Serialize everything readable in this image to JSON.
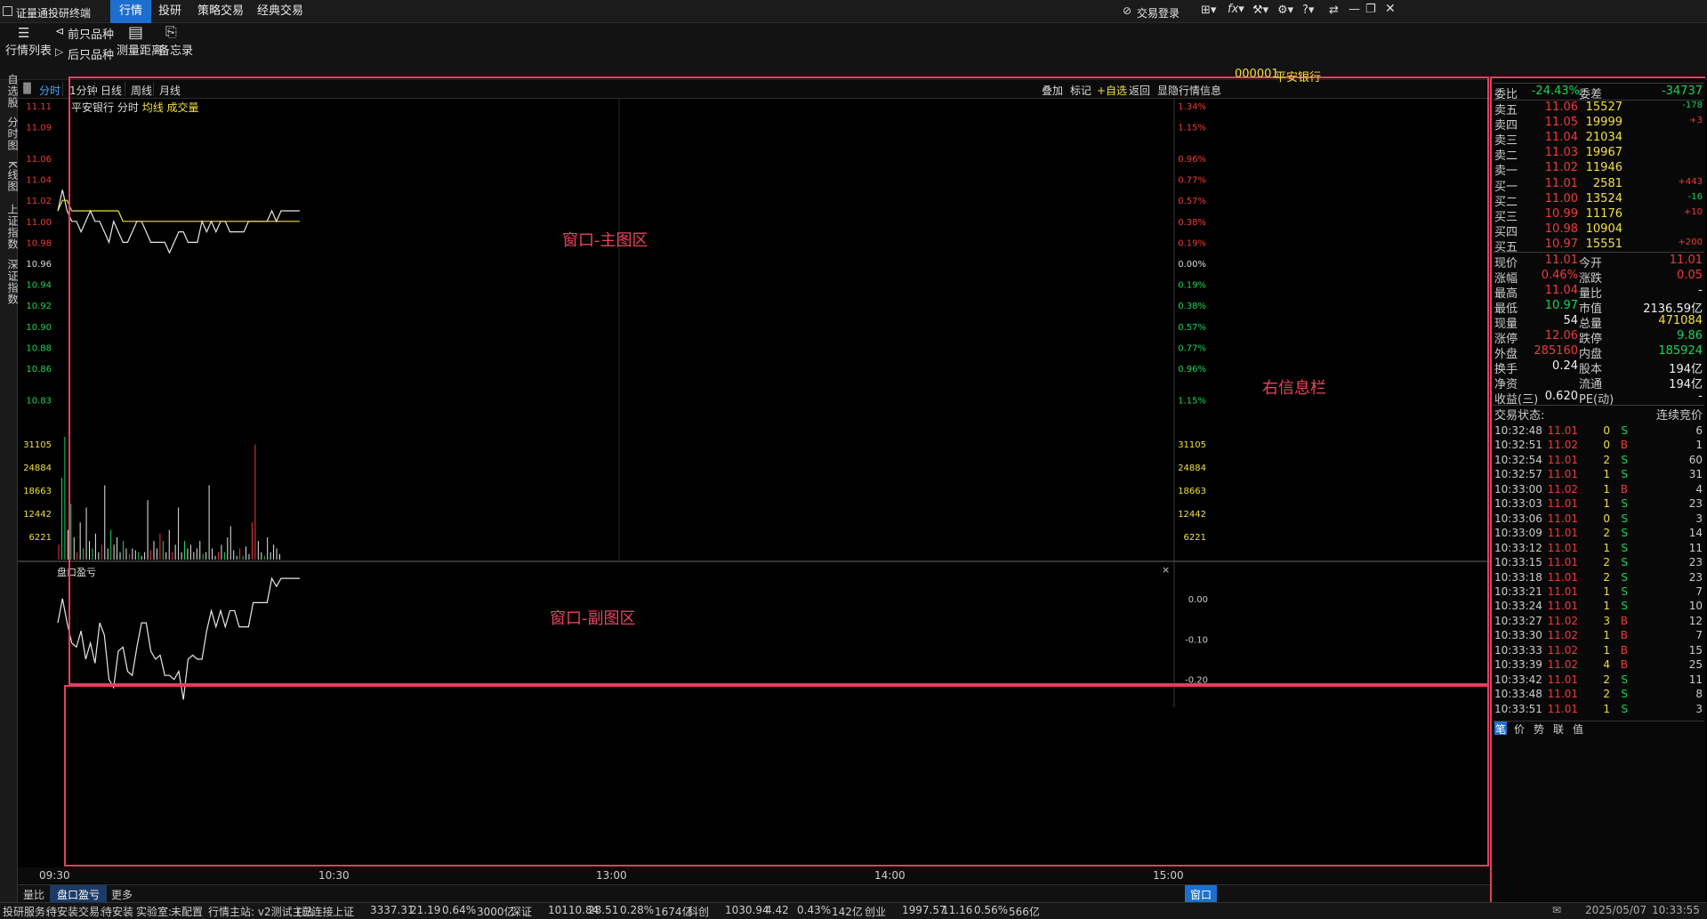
{
  "app": {
    "title": "证量通投研终端"
  },
  "menu": [
    "行情",
    "投研",
    "策略交易",
    "经典交易"
  ],
  "topright": {
    "login": "交易登录"
  },
  "toolbar": {
    "list": "行情列表",
    "prev": "前只品种",
    "next": "后只品种",
    "measure": "测量距离",
    "memo": "备忘录"
  },
  "rail": [
    "自选股",
    "分时图",
    "K线图",
    "上证指数",
    "深证指数"
  ],
  "periods": [
    "分时",
    "1分钟",
    "日线",
    "周线",
    "月线"
  ],
  "chart_actions": [
    "叠加",
    "标记",
    "+自选",
    "返回",
    "显隐行情信息"
  ],
  "stock_header": {
    "name": "平安银行",
    "mode": "分时",
    "overlay": "均线 成交量"
  },
  "zones": {
    "main": "窗口-主图区",
    "sub": "窗口-副图区",
    "right": "右信息栏"
  },
  "sub_title": "盘口盈亏",
  "sub_close": "×",
  "chart_data": [
    {
      "type": "line",
      "title": "平安银行 分时",
      "yaxis_left": [
        "11.11",
        "11.09",
        "11.06",
        "11.04",
        "11.02",
        "11.00",
        "10.98",
        "10.96",
        "10.94",
        "10.92",
        "10.90",
        "10.88",
        "10.86",
        "10.83"
      ],
      "yaxis_right": [
        "1.34%",
        "1.15%",
        "0.96%",
        "0.77%",
        "0.57%",
        "0.38%",
        "0.19%",
        "0.00%",
        "0.19%",
        "0.38%",
        "0.57%",
        "0.77%",
        "0.96%",
        "1.15%"
      ],
      "xaxis": [
        "09:30",
        "10:30",
        "13:00",
        "14:00",
        "15:00"
      ],
      "series": [
        {
          "name": "价格",
          "values": [
            11.01,
            11.03,
            11.01,
            11.0,
            11.0,
            10.99,
            11.0,
            11.01,
            11.0,
            11.0,
            10.99,
            10.98,
            11.0,
            10.99,
            10.98,
            10.98,
            10.99,
            11.0,
            11.0,
            10.99,
            10.98,
            10.98,
            10.98,
            10.98,
            10.97,
            10.98,
            10.99,
            10.99,
            10.98,
            10.98,
            10.98,
            11.0,
            10.99,
            11.0,
            10.99,
            11.0,
            11.0,
            10.99,
            10.99,
            10.99,
            10.99,
            11.0,
            11.0,
            11.0,
            11.0,
            11.0,
            11.01,
            11.0,
            11.01,
            11.01,
            11.01,
            11.01,
            11.01
          ]
        },
        {
          "name": "均线",
          "values": [
            11.01,
            11.02,
            11.02,
            11.01,
            11.01,
            11.01,
            11.01,
            11.01,
            11.01,
            11.01,
            11.01,
            11.01,
            11.01,
            11.01,
            11.0,
            11.0,
            11.0,
            11.0,
            11.0,
            11.0,
            11.0,
            11.0,
            11.0,
            11.0,
            11.0,
            11.0,
            11.0,
            11.0,
            11.0,
            11.0,
            11.0,
            11.0,
            11.0,
            11.0,
            11.0,
            11.0,
            11.0,
            11.0,
            11.0,
            11.0,
            11.0,
            11.0,
            11.0,
            11.0,
            11.0,
            11.0,
            11.0,
            11.0,
            11.0,
            11.0,
            11.0,
            11.0,
            11.0
          ]
        }
      ]
    },
    {
      "type": "bar",
      "title": "成交量",
      "yaxis": [
        "31105",
        "24884",
        "18663",
        "12442",
        "6221"
      ],
      "values": [
        4000,
        22000,
        33000,
        8000,
        15000,
        6000,
        2000,
        10000,
        3000,
        14000,
        5000,
        3000,
        7000,
        2000,
        4000,
        20000,
        3000,
        8000,
        4000,
        6000,
        2000,
        5000,
        3000,
        1500,
        3000,
        2500,
        2000,
        1000,
        2000,
        16000,
        2500,
        5000,
        3000,
        7000,
        5000,
        2000,
        8000,
        2000,
        4000,
        14000,
        2000,
        5000,
        3000,
        4000,
        2000,
        3000,
        5000,
        1500,
        2000,
        20000,
        3000,
        1000,
        2000,
        4000,
        2000,
        6000,
        9000,
        2500,
        1000,
        3000,
        1000,
        3500,
        1500,
        10000,
        31000,
        5000,
        2000,
        1000,
        6000,
        2000,
        4000,
        3000,
        1500
      ],
      "colors": [
        "r",
        "g",
        "g",
        "w",
        "g",
        "w",
        "r",
        "w",
        "g",
        "w",
        "w",
        "g",
        "w",
        "w",
        "r",
        "w",
        "w",
        "g",
        "w",
        "w",
        "w",
        "g",
        "w",
        "r",
        "w",
        "w",
        "g",
        "w",
        "w",
        "w",
        "r",
        "w",
        "w",
        "r",
        "g",
        "w",
        "w",
        "r",
        "w",
        "w",
        "w",
        "g",
        "w",
        "w",
        "w",
        "w",
        "w",
        "g",
        "w",
        "w",
        "w",
        "w",
        "r",
        "w",
        "g",
        "w",
        "w",
        "w",
        "w",
        "r",
        "g",
        "w",
        "w",
        "r",
        "r",
        "w",
        "w",
        "g",
        "w",
        "w",
        "w",
        "w",
        "w"
      ]
    },
    {
      "type": "line",
      "title": "盘口盈亏",
      "yaxis": [
        "0.00",
        "-0.10",
        "-0.20"
      ],
      "values": [
        -0.06,
        0.0,
        -0.06,
        -0.11,
        -0.12,
        -0.08,
        -0.15,
        -0.11,
        -0.16,
        -0.06,
        -0.09,
        -0.2,
        -0.22,
        -0.13,
        -0.12,
        -0.18,
        -0.19,
        -0.12,
        -0.06,
        -0.06,
        -0.13,
        -0.15,
        -0.14,
        -0.19,
        -0.19,
        -0.2,
        -0.18,
        -0.25,
        -0.15,
        -0.14,
        -0.15,
        -0.15,
        -0.08,
        -0.03,
        -0.07,
        -0.03,
        -0.07,
        -0.03,
        -0.03,
        -0.07,
        -0.07,
        -0.07,
        -0.01,
        -0.01,
        -0.01,
        -0.01,
        0.05,
        0.03,
        0.05,
        0.05,
        0.05,
        0.05,
        0.05
      ]
    }
  ],
  "quote": {
    "code": "000001",
    "name": "平安银行",
    "wb_label": "委比",
    "wb_val": "-24.43%",
    "wc_label": "委差",
    "wc_val": "-34737",
    "asks": [
      {
        "label": "卖五",
        "price": "11.06",
        "vol": "15527",
        "chg": "-178"
      },
      {
        "label": "卖四",
        "price": "11.05",
        "vol": "19999",
        "chg": "+3"
      },
      {
        "label": "卖三",
        "price": "11.04",
        "vol": "21034",
        "chg": ""
      },
      {
        "label": "卖二",
        "price": "11.03",
        "vol": "19967",
        "chg": ""
      },
      {
        "label": "卖一",
        "price": "11.02",
        "vol": "11946",
        "chg": ""
      }
    ],
    "bids": [
      {
        "label": "买一",
        "price": "11.01",
        "vol": "2581",
        "chg": "+443"
      },
      {
        "label": "买二",
        "price": "11.00",
        "vol": "13524",
        "chg": "-16"
      },
      {
        "label": "买三",
        "price": "10.99",
        "vol": "11176",
        "chg": "+10"
      },
      {
        "label": "买四",
        "price": "10.98",
        "vol": "10904",
        "chg": ""
      },
      {
        "label": "买五",
        "price": "10.97",
        "vol": "15551",
        "chg": "+200"
      }
    ],
    "stats": [
      {
        "l1": "现价",
        "v1": "11.01",
        "c1": "red",
        "l2": "今开",
        "v2": "11.01",
        "c2": "red"
      },
      {
        "l1": "涨幅",
        "v1": "0.46%",
        "c1": "red",
        "l2": "涨跌",
        "v2": "0.05",
        "c2": "red"
      },
      {
        "l1": "最高",
        "v1": "11.04",
        "c1": "red",
        "l2": "量比",
        "v2": "-",
        "c2": "white"
      },
      {
        "l1": "最低",
        "v1": "10.97",
        "c1": "green",
        "l2": "市值",
        "v2": "2136.59亿",
        "c2": "white"
      },
      {
        "l1": "现量",
        "v1": "54",
        "c1": "white",
        "l2": "总量",
        "v2": "471084",
        "c2": "yellow"
      },
      {
        "l1": "涨停",
        "v1": "12.06",
        "c1": "red",
        "l2": "跌停",
        "v2": "9.86",
        "c2": "green"
      },
      {
        "l1": "外盘",
        "v1": "285160",
        "c1": "red",
        "l2": "内盘",
        "v2": "185924",
        "c2": "green"
      },
      {
        "l1": "换手",
        "v1": "0.24",
        "c1": "white",
        "l2": "股本",
        "v2": "194亿",
        "c2": "white"
      },
      {
        "l1": "净资",
        "v1": "",
        "c1": "white",
        "l2": "流通",
        "v2": "194亿",
        "c2": "white"
      },
      {
        "l1": "收益(三)",
        "v1": "0.620",
        "c1": "white",
        "l2": "PE(动)",
        "v2": "-",
        "c2": "white"
      }
    ],
    "state_label": "交易状态:",
    "state_val": "连续竞价",
    "ticks": [
      {
        "t": "10:32:48",
        "p": "11.01",
        "pc": "red",
        "v": "0",
        "s": "S",
        "n": "6"
      },
      {
        "t": "10:32:51",
        "p": "11.02",
        "pc": "red",
        "v": "0",
        "s": "B",
        "n": "1"
      },
      {
        "t": "10:32:54",
        "p": "11.01",
        "pc": "red",
        "v": "2",
        "s": "S",
        "n": "60"
      },
      {
        "t": "10:32:57",
        "p": "11.01",
        "pc": "red",
        "v": "1",
        "s": "S",
        "n": "31"
      },
      {
        "t": "10:33:00",
        "p": "11.02",
        "pc": "red",
        "v": "1",
        "s": "B",
        "n": "4"
      },
      {
        "t": "10:33:03",
        "p": "11.01",
        "pc": "red",
        "v": "1",
        "s": "S",
        "n": "23"
      },
      {
        "t": "10:33:06",
        "p": "11.01",
        "pc": "red",
        "v": "0",
        "s": "S",
        "n": "3"
      },
      {
        "t": "10:33:09",
        "p": "11.01",
        "pc": "red",
        "v": "2",
        "s": "S",
        "n": "14"
      },
      {
        "t": "10:33:12",
        "p": "11.01",
        "pc": "red",
        "v": "1",
        "s": "S",
        "n": "11"
      },
      {
        "t": "10:33:15",
        "p": "11.01",
        "pc": "red",
        "v": "2",
        "s": "S",
        "n": "23"
      },
      {
        "t": "10:33:18",
        "p": "11.01",
        "pc": "red",
        "v": "2",
        "s": "S",
        "n": "23"
      },
      {
        "t": "10:33:21",
        "p": "11.01",
        "pc": "red",
        "v": "1",
        "s": "S",
        "n": "7"
      },
      {
        "t": "10:33:24",
        "p": "11.01",
        "pc": "red",
        "v": "1",
        "s": "S",
        "n": "10"
      },
      {
        "t": "10:33:27",
        "p": "11.02",
        "pc": "red",
        "v": "3",
        "s": "B",
        "n": "12"
      },
      {
        "t": "10:33:30",
        "p": "11.02",
        "pc": "red",
        "v": "1",
        "s": "B",
        "n": "7"
      },
      {
        "t": "10:33:33",
        "p": "11.02",
        "pc": "red",
        "v": "1",
        "s": "B",
        "n": "15"
      },
      {
        "t": "10:33:39",
        "p": "11.02",
        "pc": "red",
        "v": "4",
        "s": "B",
        "n": "25"
      },
      {
        "t": "10:33:42",
        "p": "11.01",
        "pc": "red",
        "v": "2",
        "s": "S",
        "n": "11"
      },
      {
        "t": "10:33:48",
        "p": "11.01",
        "pc": "red",
        "v": "2",
        "s": "S",
        "n": "8"
      },
      {
        "t": "10:33:51",
        "p": "11.01",
        "pc": "red",
        "v": "1",
        "s": "S",
        "n": "3"
      }
    ],
    "bottom_tabs": [
      "笔",
      "价",
      "势",
      "联",
      "值"
    ]
  },
  "bottom_tabs": [
    "量比",
    "盘口盈亏",
    "更多"
  ],
  "window_btn": "窗口",
  "status": {
    "svc": "投研服务:",
    "svc_v": "待安装",
    "trade": "交易:",
    "trade_v": "待安装",
    "lab": "实验室:",
    "lab_v": "未配置",
    "host": "行情主站: v2测试主站",
    "host_v": "(已连接",
    "idx": [
      {
        "n": "上证",
        "v": "3337.31",
        "c": "21.19",
        "p": "0.64%",
        "a": "3000亿"
      },
      {
        "n": "深证",
        "v": "10110.84",
        "c": "28.51",
        "p": "0.28%",
        "a": "1674亿"
      },
      {
        "n": "科创",
        "v": "1030.94",
        "c": "4.42",
        "p": "0.43%",
        "a": "142亿"
      },
      {
        "n": "创业",
        "v": "1997.57",
        "c": "11.16",
        "p": "0.56%",
        "a": "566亿"
      }
    ],
    "date": "2025/05/07",
    "time": "10:33:55"
  },
  "colors": {
    "up": "#f03a3a",
    "down": "#19d45a",
    "accent": "#1d6fcf",
    "zone": "#e04060"
  }
}
